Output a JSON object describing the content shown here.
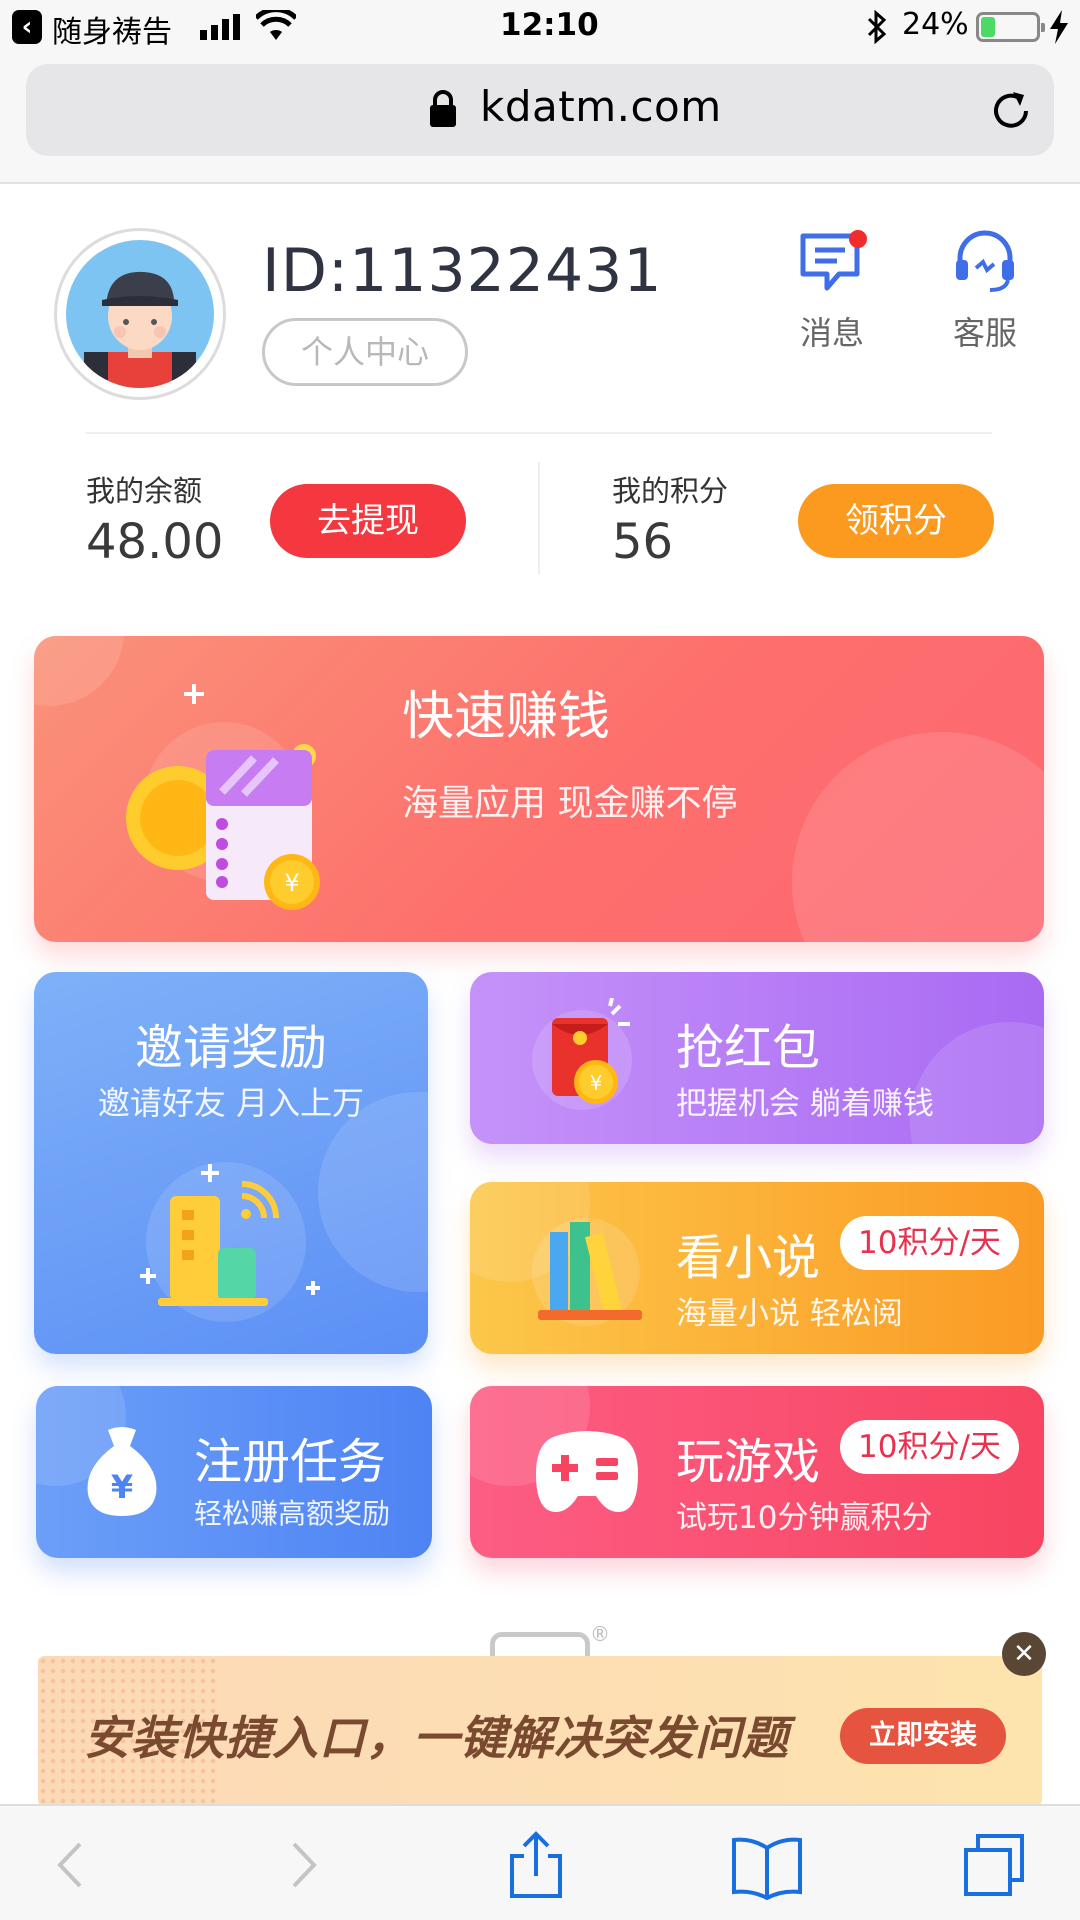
{
  "status_bar": {
    "back_app": "随身祷告",
    "time": "12:10",
    "battery_percent": "24%",
    "battery_level": 0.24
  },
  "browser": {
    "url": "kdatm.com"
  },
  "profile": {
    "user_id": "ID:11322431",
    "center_label": "个人中心",
    "messages_label": "消息",
    "service_label": "客服"
  },
  "wallet": {
    "balance_label": "我的余额",
    "balance_value": "48.00",
    "withdraw_label": "去提现",
    "points_label": "我的积分",
    "points_value": "56",
    "get_points_label": "领积分"
  },
  "cards": {
    "fast_earn": {
      "title": "快速赚钱",
      "subtitle": "海量应用 现金赚不停"
    },
    "invite": {
      "title": "邀请奖励",
      "subtitle": "邀请好友 月入上万"
    },
    "red_packet": {
      "title": "抢红包",
      "subtitle": "把握机会 躺着赚钱"
    },
    "novel": {
      "title": "看小说",
      "badge": "10积分/天",
      "subtitle": "海量小说 轻松阅"
    },
    "register": {
      "title": "注册任务",
      "subtitle": "轻松赚高额奖励"
    },
    "game": {
      "title": "玩游戏",
      "badge": "10积分/天",
      "subtitle": "试玩10分钟赢积分"
    }
  },
  "install_banner": {
    "text": "安装快捷入口，一键解决突发问题",
    "button": "立即安装",
    "close": "✕",
    "registered_mark": "®"
  },
  "colors": {
    "withdraw": "#f5383f",
    "get_points": "#fb9a1e",
    "icon_blue": "#3f6ee8"
  }
}
